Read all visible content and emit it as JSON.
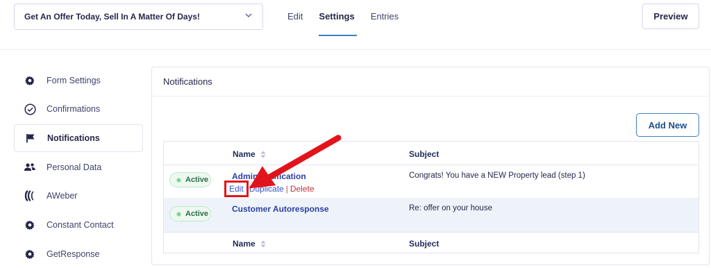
{
  "header": {
    "form_select_value": "Get An Offer Today, Sell In A Matter Of Days!",
    "tabs": [
      {
        "label": "Edit",
        "active": false
      },
      {
        "label": "Settings",
        "active": true
      },
      {
        "label": "Entries",
        "active": false
      }
    ],
    "preview_label": "Preview"
  },
  "sidebar": {
    "items": [
      {
        "label": "Form Settings",
        "icon": "gear-icon",
        "active": false
      },
      {
        "label": "Confirmations",
        "icon": "check-circle-icon",
        "active": false
      },
      {
        "label": "Notifications",
        "icon": "flag-icon",
        "active": true
      },
      {
        "label": "Personal Data",
        "icon": "users-icon",
        "active": false
      },
      {
        "label": "AWeber",
        "icon": "aweber-icon",
        "active": false
      },
      {
        "label": "Constant Contact",
        "icon": "gear-icon",
        "active": false
      },
      {
        "label": "GetResponse",
        "icon": "gear-icon",
        "active": false
      }
    ]
  },
  "panel": {
    "title": "Notifications",
    "add_new_label": "Add New",
    "columns": {
      "name": "Name",
      "subject": "Subject"
    },
    "rows": [
      {
        "status": "Active",
        "name": "Admin Notification",
        "subject": "Congrats! You have a NEW Property lead (step 1)",
        "actions": {
          "edit": "Edit",
          "duplicate": "Duplicate",
          "delete": "Delete"
        }
      },
      {
        "status": "Active",
        "name": "Customer Autoresponse",
        "subject": "Re: offer on your house"
      }
    ]
  },
  "colors": {
    "accent": "#3e7ebd",
    "link": "#2d3fa3",
    "highlight_box": "#e2141b",
    "arrow": "#e2141b",
    "active_badge": "#ecf8f0"
  }
}
